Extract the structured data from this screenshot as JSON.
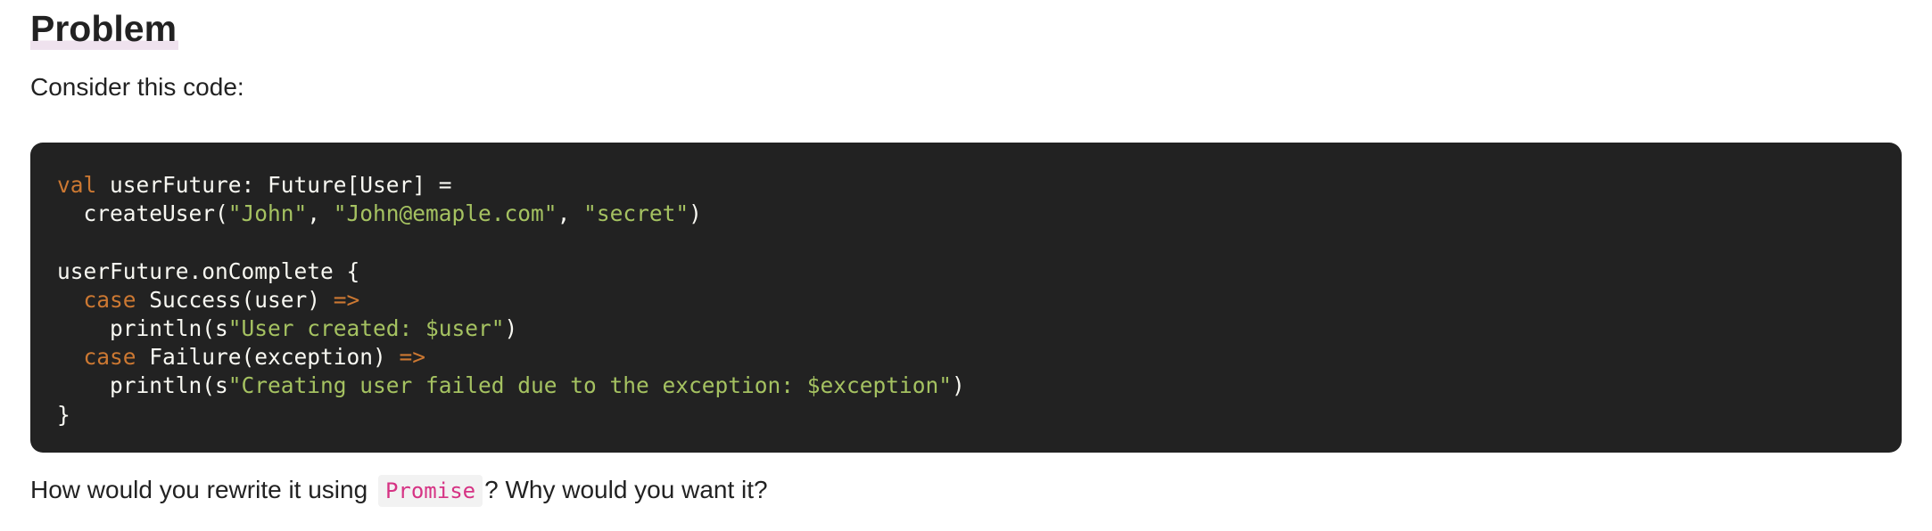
{
  "heading": "Problem",
  "intro": "Consider this code:",
  "code": {
    "lines": [
      [
        {
          "t": "val",
          "c": "kw"
        },
        {
          "t": " userFuture: Future[User] =",
          "c": ""
        }
      ],
      [
        {
          "t": "  createUser(",
          "c": ""
        },
        {
          "t": "\"John\"",
          "c": "str"
        },
        {
          "t": ", ",
          "c": ""
        },
        {
          "t": "\"John@emaple.com\"",
          "c": "str"
        },
        {
          "t": ", ",
          "c": ""
        },
        {
          "t": "\"secret\"",
          "c": "str"
        },
        {
          "t": ")",
          "c": ""
        }
      ],
      [],
      [
        {
          "t": "userFuture.onComplete {",
          "c": ""
        }
      ],
      [
        {
          "t": "  ",
          "c": ""
        },
        {
          "t": "case",
          "c": "kw"
        },
        {
          "t": " Success(user) ",
          "c": ""
        },
        {
          "t": "=>",
          "c": "arr"
        }
      ],
      [
        {
          "t": "    println(s",
          "c": ""
        },
        {
          "t": "\"User created: $user\"",
          "c": "str"
        },
        {
          "t": ")",
          "c": ""
        }
      ],
      [
        {
          "t": "  ",
          "c": ""
        },
        {
          "t": "case",
          "c": "kw"
        },
        {
          "t": " Failure(exception) ",
          "c": ""
        },
        {
          "t": "=>",
          "c": "arr"
        }
      ],
      [
        {
          "t": "    println(s",
          "c": ""
        },
        {
          "t": "\"Creating user failed due to the exception: $exception\"",
          "c": "str"
        },
        {
          "t": ")",
          "c": ""
        }
      ],
      [
        {
          "t": "}",
          "c": ""
        }
      ]
    ]
  },
  "question": {
    "before": "How would you rewrite it using ",
    "code": "Promise",
    "after": "? Why would you want it?"
  },
  "colors": {
    "text": "#222222",
    "code_background": "#222222",
    "code_text": "#f8f8f2",
    "keyword": "#cc7832",
    "string": "#a5c261",
    "inline_code_text": "#d63384",
    "inline_code_background": "#f2f2f2",
    "heading_highlight": "#efe2ee"
  }
}
